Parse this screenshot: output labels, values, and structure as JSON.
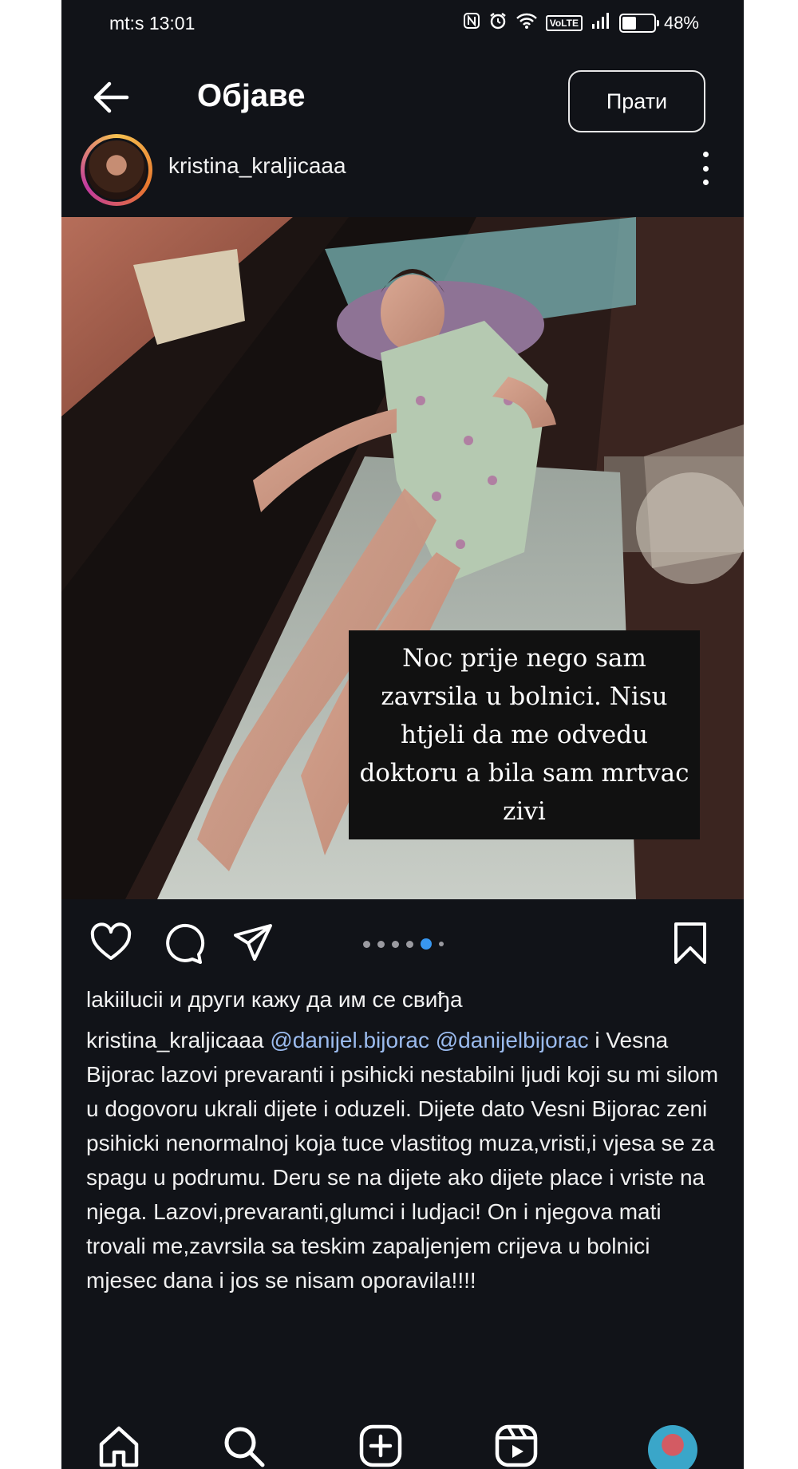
{
  "status_bar": {
    "time": "mt:s 13:01",
    "battery": "48%",
    "battery_level": 0.48,
    "icons": [
      "nfc-icon",
      "alarm-icon",
      "wifi-icon",
      "volte-icon",
      "signal-icon",
      "battery-icon"
    ],
    "volte_label": "VoLTE"
  },
  "header": {
    "title": "Објаве",
    "follow_label": "Прати"
  },
  "post": {
    "username": "kristina_kraljicaaa",
    "photo_caption": "Noc prije nego sam zavrsila u bolnici. Nisu htjeli da me odvedu doktoru a bila sam mrtvac zivi",
    "carousel": {
      "total": 6,
      "active": 4
    },
    "likes": {
      "user": "lakiilucii",
      "rest": " и други кажу да им се свиђа"
    },
    "caption": {
      "user": "kristina_kraljicaaa",
      "mention1": "@danijel.bijorac",
      "mention2": "@danijelbijorac",
      "text": " i Vesna Bijorac lazovi prevaranti i psihicki nestabilni ljudi koji su mi silom u dogovoru ukrali dijete i oduzeli. Dijete dato Vesni Bijorac zeni psihicki nenormalnoj koja tuce vlastitog muza,vristi,i vjesa se za spagu u podrumu. Deru se na dijete ako dijete place  i vriste na njega. Lazovi,prevaranti,glumci i ludjaci! On i njegova mati trovali me,zavrsila sa teskim zapaljenjem crijeva u bolnici mjesec dana i jos se nisam oporavila!!!!"
    }
  },
  "colors": {
    "background": "#111318",
    "mention": "#9bbbee",
    "carousel_active": "#3897f0"
  }
}
